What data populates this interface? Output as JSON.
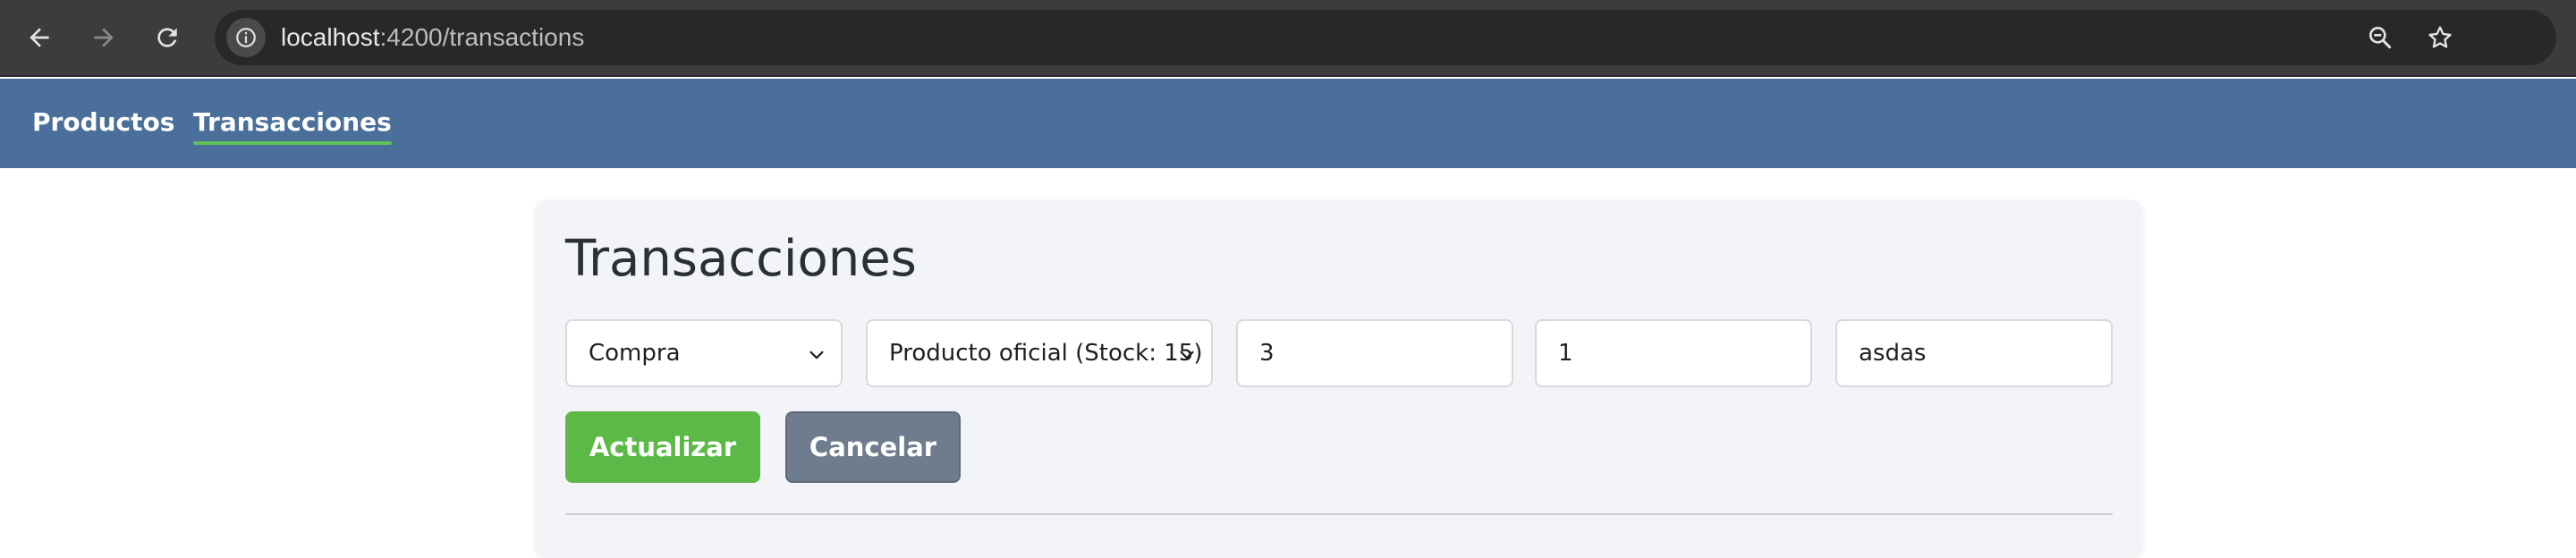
{
  "browser": {
    "url_host": "localhost",
    "url_path": ":4200/transactions",
    "icons": {
      "back": "arrow-left-icon",
      "forward": "arrow-right-icon",
      "reload": "reload-icon",
      "site_info": "info-icon",
      "zoom": "zoom-out-icon",
      "bookmark": "star-icon"
    }
  },
  "navbar": {
    "background": "#4a6f9a",
    "links": [
      {
        "label": "Productos",
        "active": false
      },
      {
        "label": "Transacciones",
        "active": true
      }
    ],
    "active_underline_color": "#5ec15a"
  },
  "card": {
    "title": "Transacciones",
    "form": {
      "type_select": {
        "value": "Compra"
      },
      "product_select": {
        "value": "Producto oficial (Stock: 15)"
      },
      "quantity_input": {
        "value": "3"
      },
      "price_input": {
        "value": "1"
      },
      "detail_input": {
        "value": "asdas"
      }
    },
    "buttons": {
      "update_label": "Actualizar",
      "update_color": "#5cb948",
      "cancel_label": "Cancelar",
      "cancel_color": "#6f7c8d"
    }
  }
}
